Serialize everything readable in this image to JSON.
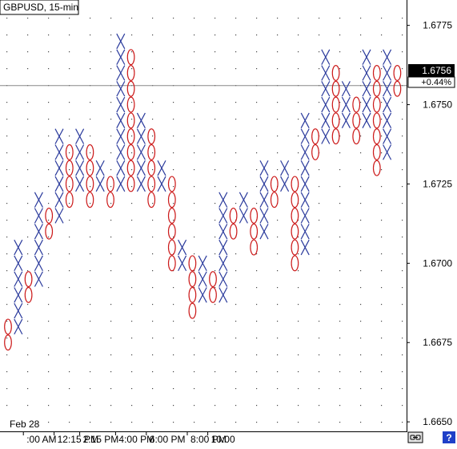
{
  "symbol_label": "GBPUSD, 15-min",
  "date_label": "Feb 28",
  "last_price": {
    "value": "1.6756",
    "change": "+0.44%"
  },
  "footer_icons": [
    "link-icon",
    "help-icon"
  ],
  "help_glyph": "?",
  "colors": {
    "x_mark": "#2a3a9c",
    "o_mark": "#cc1a1a",
    "axis": "#000000",
    "grid": "#444444",
    "price_line": "#888888"
  },
  "chart_data": {
    "type": "point-and-figure",
    "box_size": 0.0005,
    "y_range": [
      1.6647,
      1.6783
    ],
    "y_ticks": [
      1.6775,
      1.675,
      1.6725,
      1.67,
      1.6675,
      1.665
    ],
    "y_tick_labels": [
      "1.6775",
      "1.6750",
      "1.6725",
      "1.6700",
      "1.6675",
      "1.6650"
    ],
    "x_ticks": [
      {
        "label": ":00 AM",
        "col": 1.5
      },
      {
        "label": "12:15 PM",
        "col": 4.5
      },
      {
        "label": "2:15 PM",
        "col": 7
      },
      {
        "label": "4:00 PM",
        "col": 10.5
      },
      {
        "label": "6:00 PM",
        "col": 13.5
      },
      {
        "label": "8:00 PM",
        "col": 17.5
      },
      {
        "label": "10:00",
        "col": 19.5
      }
    ],
    "current_price": 1.6756,
    "columns": [
      {
        "type": "O",
        "high": 1.668,
        "low": 1.6675
      },
      {
        "type": "X",
        "high": 1.6705,
        "low": 1.668
      },
      {
        "type": "O",
        "high": 1.6695,
        "low": 1.669
      },
      {
        "type": "X",
        "high": 1.672,
        "low": 1.6695
      },
      {
        "type": "O",
        "high": 1.6715,
        "low": 1.671
      },
      {
        "type": "X",
        "high": 1.674,
        "low": 1.6715
      },
      {
        "type": "O",
        "high": 1.6735,
        "low": 1.672
      },
      {
        "type": "X",
        "high": 1.674,
        "low": 1.6725
      },
      {
        "type": "O",
        "high": 1.6735,
        "low": 1.672
      },
      {
        "type": "X",
        "high": 1.673,
        "low": 1.6725
      },
      {
        "type": "O",
        "high": 1.6725,
        "low": 1.672
      },
      {
        "type": "X",
        "high": 1.677,
        "low": 1.6725
      },
      {
        "type": "O",
        "high": 1.6765,
        "low": 1.6725
      },
      {
        "type": "X",
        "high": 1.6745,
        "low": 1.6725
      },
      {
        "type": "O",
        "high": 1.674,
        "low": 1.672
      },
      {
        "type": "X",
        "high": 1.673,
        "low": 1.6725
      },
      {
        "type": "O",
        "high": 1.6725,
        "low": 1.67
      },
      {
        "type": "X",
        "high": 1.6705,
        "low": 1.67
      },
      {
        "type": "O",
        "high": 1.67,
        "low": 1.6685
      },
      {
        "type": "X",
        "high": 1.67,
        "low": 1.669
      },
      {
        "type": "O",
        "high": 1.6695,
        "low": 1.669
      },
      {
        "type": "X",
        "high": 1.672,
        "low": 1.669
      },
      {
        "type": "O",
        "high": 1.6715,
        "low": 1.671
      },
      {
        "type": "X",
        "high": 1.672,
        "low": 1.6715
      },
      {
        "type": "O",
        "high": 1.6715,
        "low": 1.6705
      },
      {
        "type": "X",
        "high": 1.673,
        "low": 1.671
      },
      {
        "type": "O",
        "high": 1.6725,
        "low": 1.672
      },
      {
        "type": "X",
        "high": 1.673,
        "low": 1.6725
      },
      {
        "type": "O",
        "high": 1.6725,
        "low": 1.67
      },
      {
        "type": "X",
        "high": 1.6745,
        "low": 1.6705
      },
      {
        "type": "O",
        "high": 1.674,
        "low": 1.6735
      },
      {
        "type": "X",
        "high": 1.6765,
        "low": 1.674
      },
      {
        "type": "O",
        "high": 1.676,
        "low": 1.674
      },
      {
        "type": "X",
        "high": 1.6755,
        "low": 1.6745
      },
      {
        "type": "O",
        "high": 1.675,
        "low": 1.674
      },
      {
        "type": "X",
        "high": 1.6765,
        "low": 1.6745
      },
      {
        "type": "O",
        "high": 1.676,
        "low": 1.673
      },
      {
        "type": "X",
        "high": 1.6765,
        "low": 1.6735
      },
      {
        "type": "O",
        "high": 1.676,
        "low": 1.6755
      }
    ]
  }
}
